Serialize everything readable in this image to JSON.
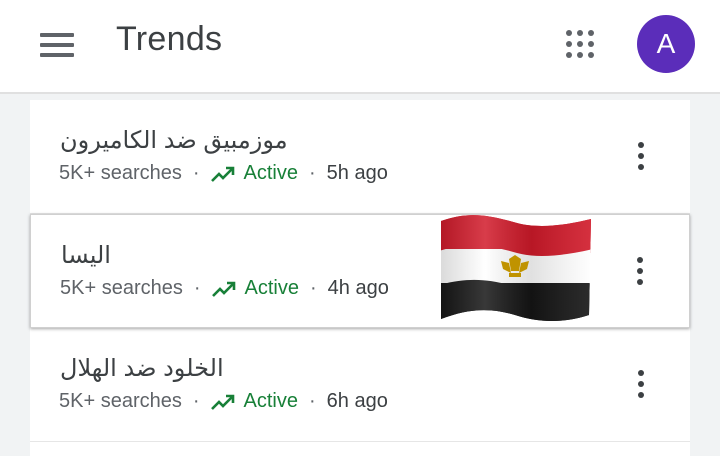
{
  "header": {
    "title": "Trends",
    "avatar_letter": "A"
  },
  "colors": {
    "accent_green": "#188038",
    "avatar_bg": "#5b2dba"
  },
  "items": [
    {
      "title": "موزمبيق ضد الكاميرون",
      "searches": "5K+ searches",
      "status": "Active",
      "time": "5h ago"
    },
    {
      "title": "اليسا",
      "searches": "5K+ searches",
      "status": "Active",
      "time": "4h ago",
      "image": "egypt-flag"
    },
    {
      "title": "الخلود ضد الهلال",
      "searches": "5K+ searches",
      "status": "Active",
      "time": "6h ago"
    }
  ]
}
